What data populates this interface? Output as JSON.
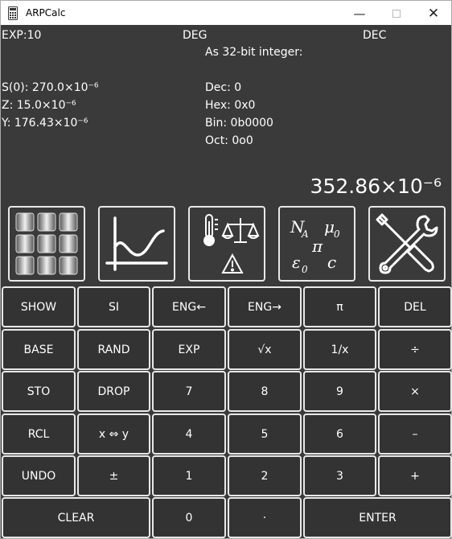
{
  "window": {
    "title": "ARPCalc",
    "minimize_glyph": "—",
    "close_glyph": "✕"
  },
  "status": {
    "exp_mode": "EXP:10",
    "angle_mode": "DEG",
    "base_mode": "DEC"
  },
  "integer_view": {
    "heading": "As 32-bit integer:",
    "dec": "Dec: 0",
    "hex": "Hex: 0x0",
    "bin": "Bin: 0b0000",
    "oct": "Oct: 0o0"
  },
  "stack": {
    "s0": "S(0): 270.0×10⁻⁶",
    "z": "Z: 15.0×10⁻⁶",
    "y": "Y: 176.43×10⁻⁶",
    "x_value": "352.86×10⁻⁶"
  },
  "icon_buttons": [
    {
      "name": "matrix-grid-icon"
    },
    {
      "name": "function-plot-icon"
    },
    {
      "name": "units-conversion-icon"
    },
    {
      "name": "physical-constants-icon",
      "labels": [
        "N",
        "A",
        "μ",
        "0",
        "π",
        "ε",
        "0",
        "c"
      ]
    },
    {
      "name": "tools-settings-icon"
    }
  ],
  "keys": {
    "show": "SHOW",
    "si": "SI",
    "eng_left": "ENG←",
    "eng_right": "ENG→",
    "pi": "π",
    "del": "DEL",
    "base": "BASE",
    "rand": "RAND",
    "exp": "EXP",
    "sqrt": "√x",
    "inv": "1/x",
    "div": "÷",
    "sto": "STO",
    "drop": "DROP",
    "k7": "7",
    "k8": "8",
    "k9": "9",
    "mul": "×",
    "rcl": "RCL",
    "swap": "x ⇔ y",
    "k4": "4",
    "k5": "5",
    "k6": "6",
    "minus": "–",
    "undo": "UNDO",
    "plusminus": "±",
    "k1": "1",
    "k2": "2",
    "k3": "3",
    "plus": "+",
    "clear": "CLEAR",
    "k0": "0",
    "dot": "·",
    "enter": "ENTER"
  },
  "colors": {
    "background": "#3a3a3a",
    "key_border": "#e8e8e8",
    "text": "#ffffff"
  }
}
